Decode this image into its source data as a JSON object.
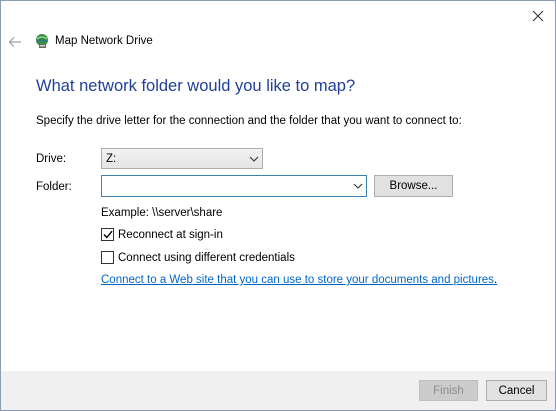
{
  "window": {
    "title": "Map Network Drive",
    "close_icon": "close-icon",
    "back_icon": "back-arrow-icon",
    "app_icon": "network-drive-icon"
  },
  "content": {
    "heading": "What network folder would you like to map?",
    "instruction": "Specify the drive letter for the connection and the folder that you want to connect to:",
    "drive_label": "Drive:",
    "drive_value": "Z:",
    "folder_label": "Folder:",
    "folder_value": "",
    "browse_label": "Browse...",
    "example": "Example: \\\\server\\share",
    "reconnect_label": "Reconnect at sign-in",
    "reconnect_checked": true,
    "credentials_label": "Connect using different credentials",
    "credentials_checked": false,
    "link_text": "Connect to a Web site that you can use to store your documents and pictures",
    "link_suffix": "."
  },
  "footer": {
    "finish_label": "Finish",
    "finish_enabled": false,
    "cancel_label": "Cancel"
  },
  "colors": {
    "heading": "#1f3f99",
    "link": "#0066cc",
    "focus_border": "#3c7fb1"
  }
}
